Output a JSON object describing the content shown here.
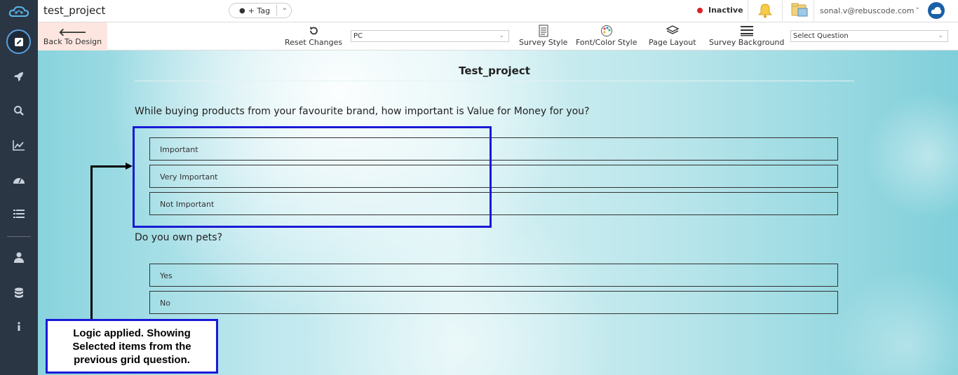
{
  "app": {
    "project_name": "test_project",
    "tag_label": "+ Tag",
    "status": "Inactive",
    "status_color": "#d9232d",
    "user_email": "sonal.v@rebuscode.com"
  },
  "sidebar": {
    "items": [
      {
        "icon": "edit-icon",
        "active": true
      },
      {
        "icon": "rocket-icon"
      },
      {
        "icon": "search-icon"
      },
      {
        "icon": "analytics-icon"
      },
      {
        "icon": "dashboard-icon"
      },
      {
        "icon": "list-icon"
      },
      {
        "icon": "user-icon"
      },
      {
        "icon": "database-icon"
      },
      {
        "icon": "info-icon"
      }
    ]
  },
  "toolbar": {
    "back_label": "Back To Design",
    "reset_label": "Reset Changes",
    "device_select": "PC",
    "survey_style_label": "Survey Style",
    "font_color_label": "Font/Color Style",
    "page_layout_label": "Page Layout",
    "survey_background_label": "Survey Background",
    "question_select_placeholder": "Select Question"
  },
  "survey": {
    "title": "Test_project",
    "questions": [
      {
        "text": "While buying products from your favourite brand, how important is Value for Money for you?",
        "options": [
          "Important",
          "Very Important",
          "Not Important"
        ]
      },
      {
        "text": "Do you own pets?",
        "options": [
          "Yes",
          "No"
        ]
      }
    ]
  },
  "annotation": {
    "callout_line1": "Logic applied. Showing",
    "callout_line2": "Selected items from the",
    "callout_line3": "previous grid question."
  },
  "colors": {
    "sidebar_bg": "#2b3645",
    "back_button_bg": "#fde6e0",
    "annotation_border": "#1a1ad6"
  }
}
